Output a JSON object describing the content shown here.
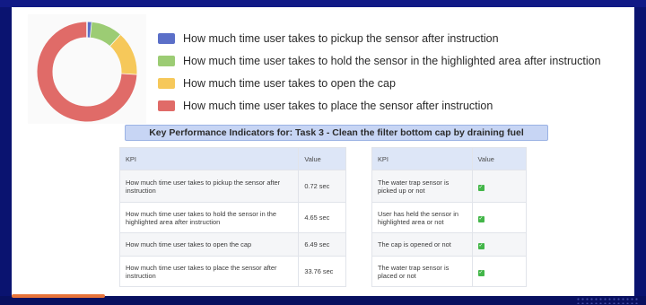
{
  "chart_data": {
    "type": "pie",
    "categories": [
      "How much time user takes to pickup the sensor after instruction",
      "How much time user takes to hold the sensor in the highlighted area after instruction",
      "How much time user takes to open the cap",
      "How much time user takes to place the sensor after instruction"
    ],
    "values": [
      0.72,
      4.65,
      6.49,
      33.76
    ],
    "colors": [
      "#5b6fc8",
      "#9ccc74",
      "#f6c85a",
      "#e06b68"
    ],
    "legend": "right",
    "title": ""
  },
  "kpi_title": "Key Performance Indicators for: Task 3 - Clean the filter bottom cap by draining fuel",
  "timing_table": {
    "headers": [
      "KPI",
      "Value"
    ],
    "rows": [
      [
        "How much time user takes to pickup the sensor after instruction",
        "0.72 sec"
      ],
      [
        "How much time user takes to hold the sensor in the highlighted area after instruction",
        "4.65 sec"
      ],
      [
        "How much time user takes to open the cap",
        "6.49 sec"
      ],
      [
        "How much time user takes to place the sensor after instruction",
        "33.76 sec"
      ]
    ]
  },
  "status_table": {
    "headers": [
      "KPI",
      "Value"
    ],
    "check_icon": "check-icon",
    "rows": [
      [
        "The water trap sensor is picked up or not",
        "✓"
      ],
      [
        "User has held the sensor in highlighted area or not",
        "✓"
      ],
      [
        "The cap is opened or not",
        "✓"
      ],
      [
        "The water trap sensor is placed or not",
        "✓"
      ]
    ]
  }
}
